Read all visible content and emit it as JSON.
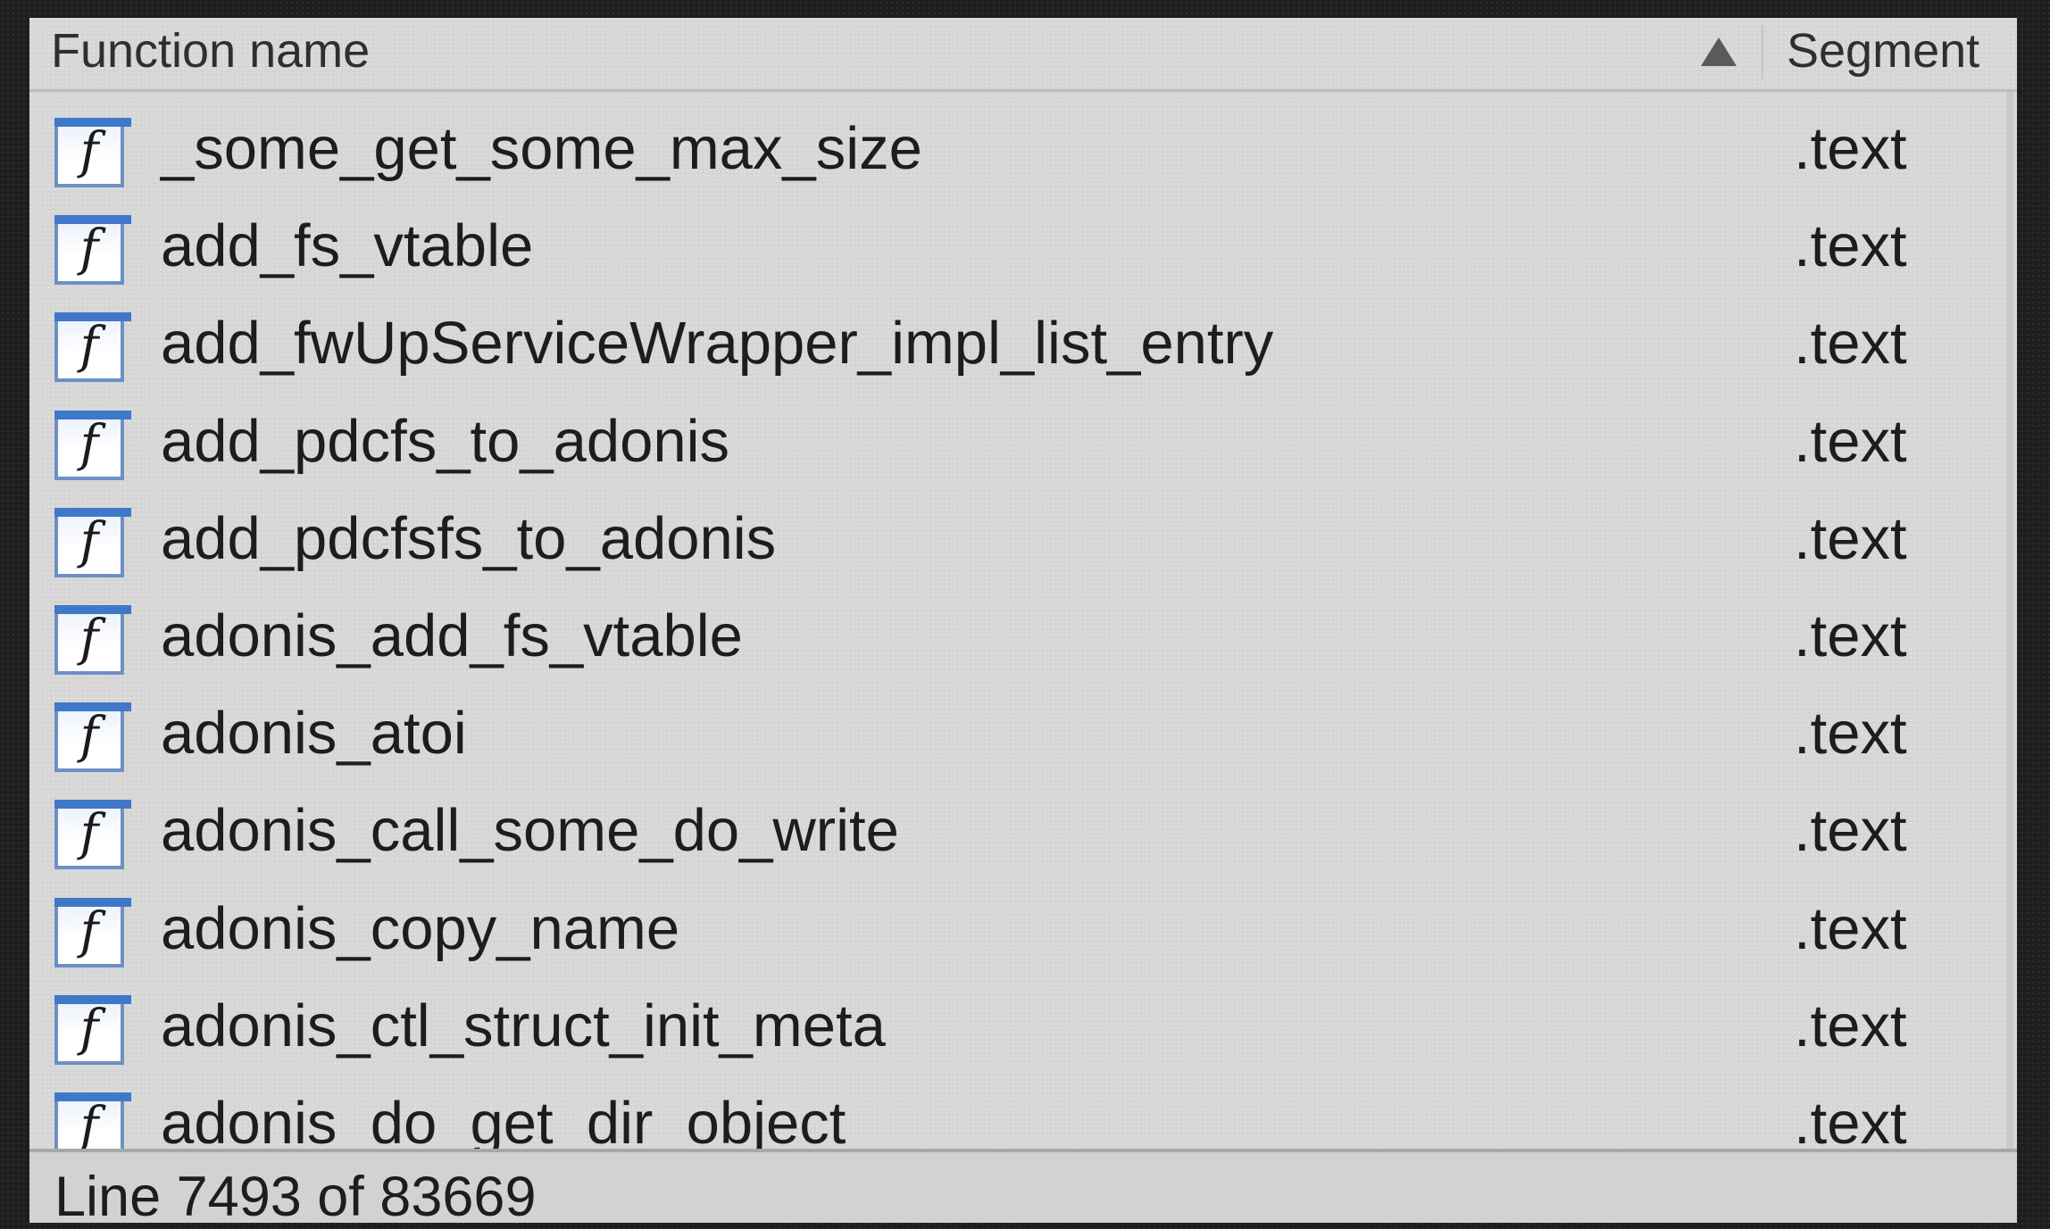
{
  "header": {
    "function_name_label": "Function name",
    "segment_label": "Segment",
    "sort_indicator": "up-triangle"
  },
  "rows": [
    {
      "icon": "function-icon",
      "icon_glyph": "f",
      "name": "_some_get_some_max_size",
      "segment": ".text"
    },
    {
      "icon": "function-icon",
      "icon_glyph": "f",
      "name": "add_fs_vtable",
      "segment": ".text"
    },
    {
      "icon": "function-icon",
      "icon_glyph": "f",
      "name": "add_fwUpServiceWrapper_impl_list_entry",
      "segment": ".text"
    },
    {
      "icon": "function-icon",
      "icon_glyph": "f",
      "name": "add_pdcfs_to_adonis",
      "segment": ".text"
    },
    {
      "icon": "function-icon",
      "icon_glyph": "f",
      "name": "add_pdcfsfs_to_adonis",
      "segment": ".text"
    },
    {
      "icon": "function-icon",
      "icon_glyph": "f",
      "name": "adonis_add_fs_vtable",
      "segment": ".text"
    },
    {
      "icon": "function-icon",
      "icon_glyph": "f",
      "name": "adonis_atoi",
      "segment": ".text"
    },
    {
      "icon": "function-icon",
      "icon_glyph": "f",
      "name": "adonis_call_some_do_write",
      "segment": ".text"
    },
    {
      "icon": "function-icon",
      "icon_glyph": "f",
      "name": "adonis_copy_name",
      "segment": ".text"
    },
    {
      "icon": "function-icon",
      "icon_glyph": "f",
      "name": "adonis_ctl_struct_init_meta",
      "segment": ".text"
    },
    {
      "icon": "function-icon",
      "icon_glyph": "f",
      "name": "adonis_do_get_dir_object",
      "segment": ".text"
    }
  ],
  "status": {
    "text": "Line 7493 of 83669"
  },
  "colors": {
    "icon_border": "#6d90c4",
    "icon_top_bar": "#3f78c8",
    "panel_bg": "#d6d6d6",
    "outer_bg": "#1e1e1e"
  }
}
